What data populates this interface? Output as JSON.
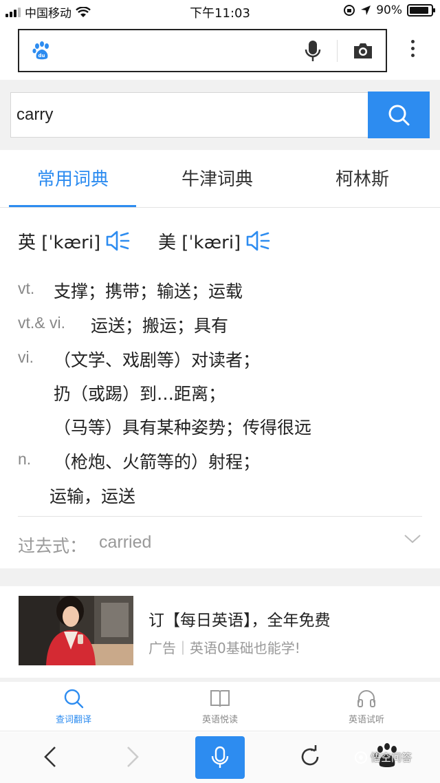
{
  "status_bar": {
    "carrier": "中国移动",
    "time": "下午11:03",
    "battery": "90%"
  },
  "search": {
    "query": "carry"
  },
  "tabs": [
    {
      "label": "常用词典",
      "active": true
    },
    {
      "label": "牛津词典",
      "active": false
    },
    {
      "label": "柯林斯",
      "active": false
    }
  ],
  "phonetics": {
    "uk": "英 [ˈkæri]",
    "us": "美 [ˈkæri]"
  },
  "definitions": [
    {
      "pos": "vt.",
      "text": "支撑；携带；输送；运载"
    },
    {
      "pos": "vt.& vi.",
      "text": "运送；搬运；具有"
    },
    {
      "pos": "vi.",
      "lines": [
        "（文学、戏剧等）对读者；",
        "扔（或踢）到…距离；",
        "（马等）具有某种姿势；传得很远"
      ]
    },
    {
      "pos": "n.",
      "lines": [
        "（枪炮、火箭等的）射程；",
        "运输，运送"
      ]
    }
  ],
  "past_tense": {
    "label": "过去式：",
    "value": "carried"
  },
  "ad": {
    "title": "订【每日英语】，全年免费",
    "subtitle": "广告｜英语0基础也能学!"
  },
  "bottom_nav": [
    {
      "label": "查词翻译",
      "icon": "search-icon",
      "active": true
    },
    {
      "label": "英语悦读",
      "icon": "book-icon",
      "active": false
    },
    {
      "label": "英语试听",
      "icon": "headphones-icon",
      "active": false
    }
  ],
  "watermark": "悟空问答",
  "colors": {
    "accent": "#2d8cf0",
    "muted": "#888888"
  }
}
